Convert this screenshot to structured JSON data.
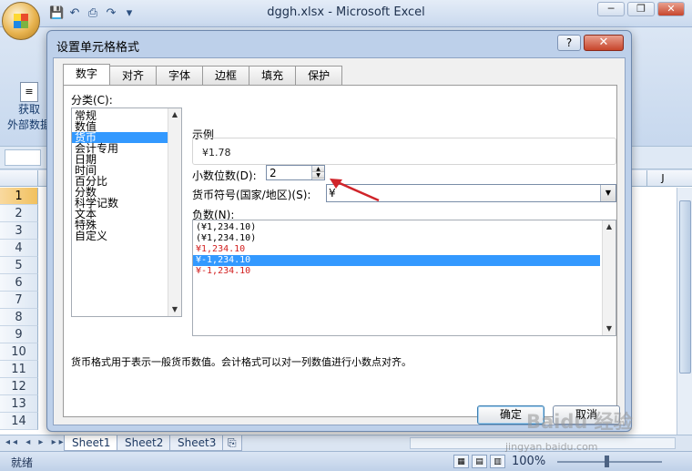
{
  "window": {
    "title": "dggh.xlsx - Microsoft Excel",
    "min": "─",
    "restore": "❐",
    "close": "✕"
  },
  "qat": {
    "save_icon": "💾",
    "undo_icon": "↶",
    "print_icon": "⎙",
    "redo_icon": "↷",
    "more_icon": "▾"
  },
  "ribbon": {
    "get_data_line1": "获取",
    "get_data_line2": "外部数据"
  },
  "grid": {
    "col_label": "J",
    "rows": [
      "1",
      "2",
      "3",
      "4",
      "5",
      "6",
      "7",
      "8",
      "9",
      "10",
      "11",
      "12",
      "13",
      "14"
    ]
  },
  "sheets": {
    "nav": "◂◂ ◂ ▸ ▸▸",
    "tabs": [
      "Sheet1",
      "Sheet2",
      "Sheet3"
    ],
    "insert_icon": "⎘"
  },
  "status": {
    "ready": "就绪",
    "zoom": "100%"
  },
  "dialog": {
    "title": "设置单元格格式",
    "help": "?",
    "close": "✕",
    "tabs": [
      "数字",
      "对齐",
      "字体",
      "边框",
      "填充",
      "保护"
    ],
    "category_label": "分类(C):",
    "categories": [
      "常规",
      "数值",
      "货币",
      "会计专用",
      "日期",
      "时间",
      "百分比",
      "分数",
      "科学记数",
      "文本",
      "特殊",
      "自定义"
    ],
    "sample_label": "示例",
    "sample_value": "¥1.78",
    "decimal_label": "小数位数(D):",
    "decimal_value": "2",
    "currency_label": "货币符号(国家/地区)(S):",
    "currency_value": "¥",
    "negative_label": "负数(N):",
    "negatives": [
      "(¥1,234.10)",
      "(¥1,234.10)",
      "¥1,234.10",
      "¥-1,234.10",
      "¥-1,234.10"
    ],
    "description": "货币格式用于表示一般货币数值。会计格式可以对一列数值进行小数点对齐。",
    "ok": "确定",
    "cancel": "取消"
  },
  "watermark": {
    "brand": "Baidu 经验",
    "url": "jingyan.baidu.com"
  },
  "colors": {
    "selection": "#3399ff",
    "negative_red": "#d21f1f",
    "arrow": "#d0242a"
  }
}
